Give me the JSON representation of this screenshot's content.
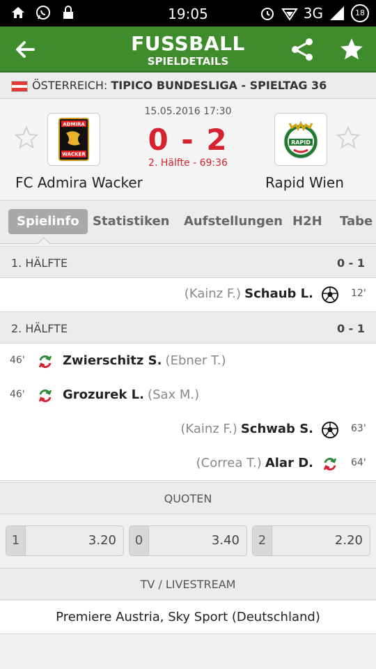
{
  "status_bar": {
    "time": "19:05",
    "network": "3G",
    "battery": "18",
    "left_icons": [
      "home-icon",
      "whatsapp-icon",
      "lock-icon"
    ],
    "right_icons": [
      "alarm-icon",
      "wifi-icon",
      "signal-icon"
    ]
  },
  "app_bar": {
    "title": "FUSSBALL",
    "subtitle": "SPIELDETAILS",
    "icons": [
      "back-arrow-icon",
      "share-icon",
      "star-icon"
    ]
  },
  "league": {
    "country": "ÖSTERREICH:",
    "name": "TIPICO BUNDESLIGA - SPIELTAG 36",
    "flag_colors": [
      "#e53935",
      "#ffffff",
      "#e53935"
    ]
  },
  "match": {
    "datetime": "15.05.2016 17:30",
    "score": "0 - 2",
    "status": "2. Hälfte - 69:36",
    "home_team": "FC Admira Wacker",
    "away_team": "Rapid Wien",
    "home_crest_text": [
      "ADMIRA",
      "WACKER"
    ],
    "away_crest_text": "RAPID"
  },
  "tabs": [
    {
      "label": "Spielinfo",
      "active": true
    },
    {
      "label": "Statistiken",
      "active": false
    },
    {
      "label": "Aufstellungen",
      "active": false
    },
    {
      "label": "H2H",
      "active": false
    },
    {
      "label": "Tabe",
      "active": false
    }
  ],
  "halves": [
    {
      "label": "1. HÄLFTE",
      "result": "0 - 1",
      "events": [
        {
          "side": "away",
          "minute": "12'",
          "assist": "(Kainz F.)",
          "player": "Schaub L.",
          "icon": "goal-ball-icon"
        }
      ]
    },
    {
      "label": "2. HÄLFTE",
      "result": "0 - 1",
      "events": [
        {
          "side": "home",
          "minute": "46'",
          "player": "Zwierschitz S.",
          "assist": "(Ebner T.)",
          "icon": "substitution-icon"
        },
        {
          "side": "home",
          "minute": "46'",
          "player": "Grozurek L.",
          "assist": "(Sax M.)",
          "icon": "substitution-icon"
        },
        {
          "side": "away",
          "minute": "63'",
          "assist": "(Kainz F.)",
          "player": "Schwab S.",
          "icon": "goal-ball-icon"
        },
        {
          "side": "away",
          "minute": "64'",
          "assist": "(Correa T.)",
          "player": "Alar D.",
          "icon": "substitution-icon"
        }
      ]
    }
  ],
  "odds": {
    "header": "QUOTEN",
    "items": [
      {
        "key": "1",
        "value": "3.20"
      },
      {
        "key": "0",
        "value": "3.40"
      },
      {
        "key": "2",
        "value": "2.20"
      }
    ]
  },
  "tv": {
    "header": "TV / LIVESTREAM",
    "channels": "Premiere Austria, Sky Sport (Deutschland)"
  },
  "colors": {
    "brand_green": "#3f8c2d",
    "score_red": "#d6212e"
  }
}
